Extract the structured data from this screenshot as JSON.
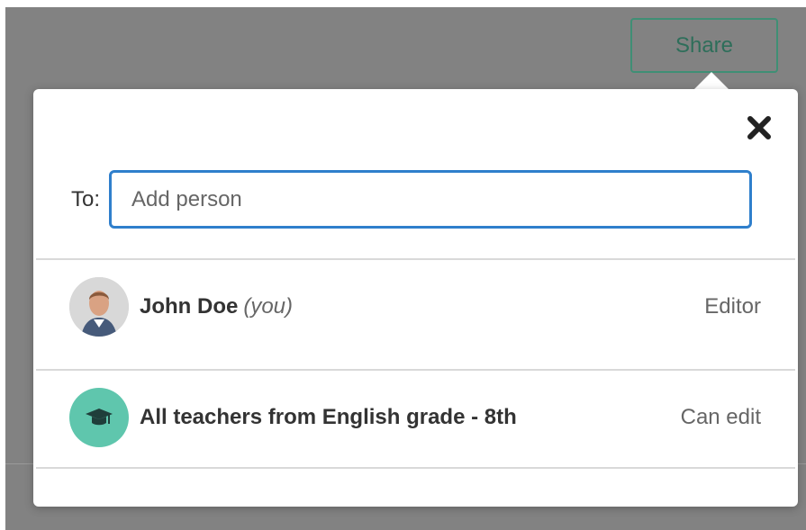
{
  "header": {
    "share_label": "Share"
  },
  "dialog": {
    "close_icon": "close-icon",
    "to_label": "To:",
    "input_placeholder": "Add person",
    "input_value": "",
    "members": [
      {
        "name": "John Doe",
        "suffix": "(you)",
        "role": "Editor",
        "avatar_type": "user-photo"
      },
      {
        "name": "All teachers from English grade - 8th",
        "suffix": "",
        "role": "Can edit",
        "avatar_type": "graduation-cap-icon"
      }
    ]
  },
  "colors": {
    "accent_green": "#3f8f75",
    "input_border_blue": "#2f7fcc",
    "group_avatar_teal": "#5fc6ad",
    "backdrop_gray": "#828282"
  }
}
